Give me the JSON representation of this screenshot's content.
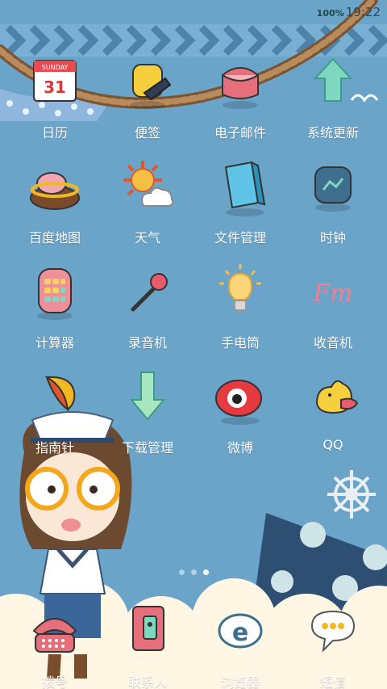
{
  "status_bar": {
    "battery": "100%",
    "time": "19:22"
  },
  "apps": [
    {
      "label": "日历",
      "icon": "calendar-icon",
      "calendar_day": "SUNDAY",
      "calendar_date": "31"
    },
    {
      "label": "便签",
      "icon": "memo-icon"
    },
    {
      "label": "电子邮件",
      "icon": "email-icon"
    },
    {
      "label": "系统更新",
      "icon": "system-update-icon"
    },
    {
      "label": "百度地图",
      "icon": "map-icon"
    },
    {
      "label": "天气",
      "icon": "weather-icon"
    },
    {
      "label": "文件管理",
      "icon": "file-manager-icon"
    },
    {
      "label": "时钟",
      "icon": "clock-icon"
    },
    {
      "label": "计算器",
      "icon": "calculator-icon"
    },
    {
      "label": "录音机",
      "icon": "recorder-icon"
    },
    {
      "label": "手电筒",
      "icon": "flashlight-icon"
    },
    {
      "label": "收音机",
      "icon": "radio-icon",
      "radio_text": "Fm"
    },
    {
      "label": "指南针",
      "icon": "compass-icon"
    },
    {
      "label": "下载管理",
      "icon": "download-icon"
    },
    {
      "label": "微博",
      "icon": "weibo-icon"
    },
    {
      "label": "QQ",
      "icon": "qq-icon"
    }
  ],
  "page_indicator": {
    "pages": 3,
    "current": 3
  },
  "dock": [
    {
      "label": "拨号",
      "icon": "phone-icon"
    },
    {
      "label": "联系人",
      "icon": "contacts-icon"
    },
    {
      "label": "浏览器",
      "icon": "browser-icon"
    },
    {
      "label": "短信",
      "icon": "sms-icon"
    }
  ],
  "colors": {
    "background": "#6aa4c9",
    "rope": "#a27a52",
    "cloud": "#fff6e4",
    "navy": "#2f4f72"
  }
}
